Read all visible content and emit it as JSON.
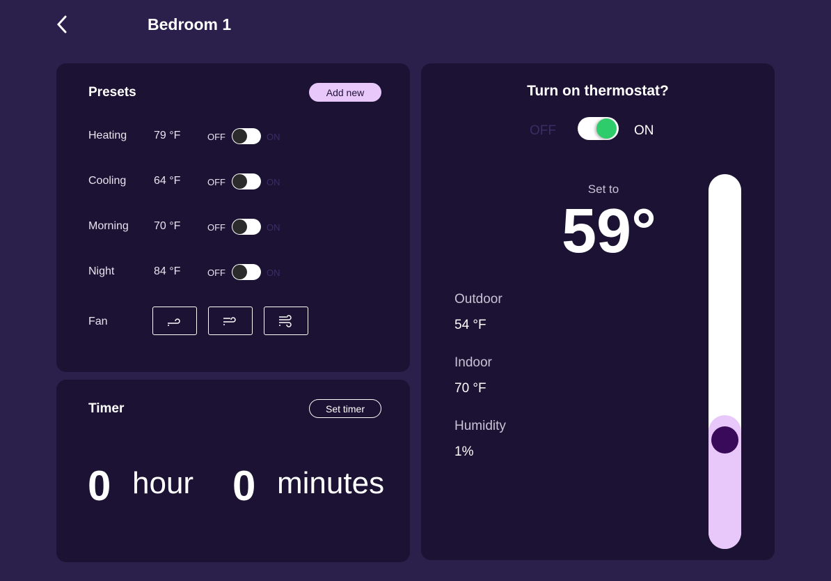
{
  "header": {
    "title": "Bedroom 1",
    "back_icon": "chevron-left-icon"
  },
  "presets": {
    "title": "Presets",
    "add_label": "Add new",
    "off_label": "OFF",
    "on_label": "ON",
    "items": [
      {
        "name": "Heating",
        "temp": "79 °F",
        "on": false
      },
      {
        "name": "Cooling",
        "temp": "64 °F",
        "on": false
      },
      {
        "name": "Morning",
        "temp": "70 °F",
        "on": false
      },
      {
        "name": "Night",
        "temp": "84 °F",
        "on": false
      }
    ],
    "fan_label": "Fan",
    "fan_icons": [
      "wind-low-icon",
      "wind-medium-icon",
      "wind-high-icon"
    ]
  },
  "timer": {
    "title": "Timer",
    "set_label": "Set timer",
    "hours": "0",
    "hour_unit": "hour",
    "minutes": "0",
    "minute_unit": "minutes"
  },
  "thermostat": {
    "title": "Turn on thermostat?",
    "off_label": "OFF",
    "on_label": "ON",
    "on": true,
    "set_to_label": "Set to",
    "set_value": "59°",
    "slider_level": 0.29,
    "stats": [
      {
        "label": "Outdoor",
        "value": "54 °F"
      },
      {
        "label": "Indoor",
        "value": "70 °F"
      },
      {
        "label": "Humidity",
        "value": "1%"
      }
    ]
  },
  "colors": {
    "background": "#2b1f4b",
    "card": "#1c1233",
    "accent": "#e8c8fb",
    "toggle_on": "#2ecc6a",
    "thumb": "#3a0a5a"
  }
}
